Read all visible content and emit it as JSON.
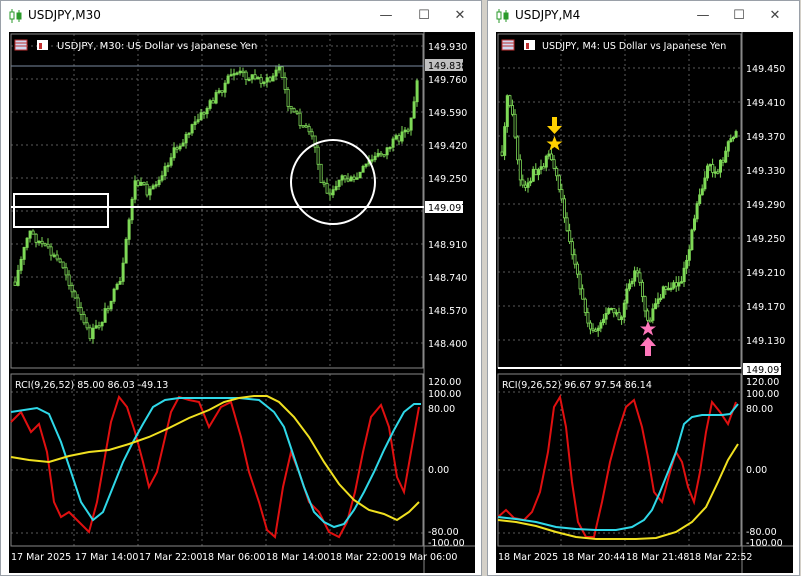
{
  "windows": [
    {
      "title": "USDJPY,M30",
      "chart_caption": "USDJPY, M30:  US Dollar vs Japanese Yen",
      "price_labels": [
        "149.930",
        "149.760",
        "149.590",
        "149.420",
        "149.250",
        "148.910",
        "148.740",
        "148.570",
        "148.400"
      ],
      "current_price": "149.838",
      "hline_price": "149.097",
      "indicator_caption": "RCI(9,26,52) 85.00 86.03 -49.13",
      "indicator_labels": [
        "120.00",
        "100.00",
        "80.00",
        "0.00",
        "-80.00",
        "-100.00"
      ],
      "time_labels": [
        "17 Mar 2025",
        "17 Mar 14:00",
        "17 Mar 22:00",
        "18 Mar 06:00",
        "18 Mar 14:00",
        "18 Mar 22:00",
        "19 Mar 06:00"
      ]
    },
    {
      "title": "USDJPY,M4",
      "chart_caption": "USDJPY, M4:  US Dollar vs Japanese Yen",
      "price_labels": [
        "149.450",
        "149.410",
        "149.370",
        "149.330",
        "149.290",
        "149.250",
        "149.210",
        "149.170",
        "149.130"
      ],
      "hline_price": "149.097",
      "indicator_caption": "RCI(9,26,52) 96.67 97.54 86.14",
      "indicator_labels": [
        "120.00",
        "100.00",
        "80.00",
        "0.00",
        "-80.00",
        "-100.00"
      ],
      "time_labels": [
        "18 Mar 2025",
        "18 Mar 20:44",
        "18 Mar 21:48",
        "18 Mar 22:52"
      ]
    }
  ],
  "window_controls": {
    "minimize": "—",
    "maximize": "☐",
    "close": "✕"
  },
  "colors": {
    "candles": "#7ed957",
    "rci_short": "#e01010",
    "rci_mid": "#2fd8e8",
    "rci_long": "#f0e020",
    "grid": "#5a5a5a",
    "sell_signal": "#ffd000",
    "buy_signal": "#ff77bb"
  },
  "annotations": {
    "left": [
      "white-rectangle",
      "white-circle"
    ],
    "right": [
      "yellow-down-arrow",
      "yellow-star",
      "pink-star",
      "pink-up-arrow"
    ]
  }
}
